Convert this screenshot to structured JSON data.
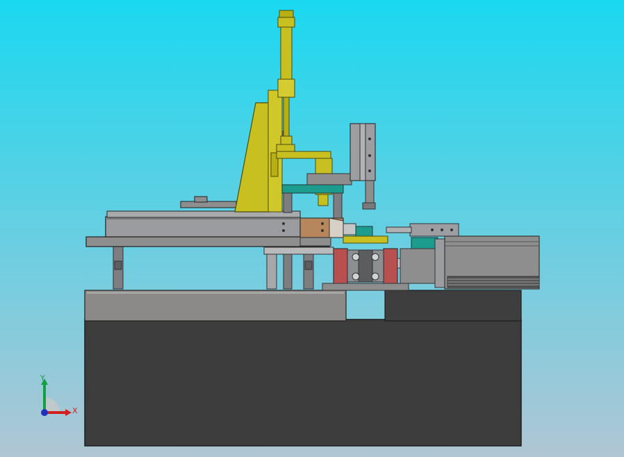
{
  "viewport": {
    "background_top": "#1ad8f0",
    "background_bottom": "#b0c6d4"
  },
  "model": {
    "base_color": "#3c3c3c",
    "table_color": "#8a8a8a",
    "cylinder_color": "#c8c020",
    "motor_color": "#8e8e8e",
    "copper_block_color": "#b8865c",
    "clamp_color": "#b85050",
    "teal_color": "#1c9c8c"
  },
  "triad": {
    "y_label": "Y",
    "x_label": "X",
    "y_color": "#10a040",
    "x_color": "#d02020",
    "z_color": "#2030c0"
  }
}
